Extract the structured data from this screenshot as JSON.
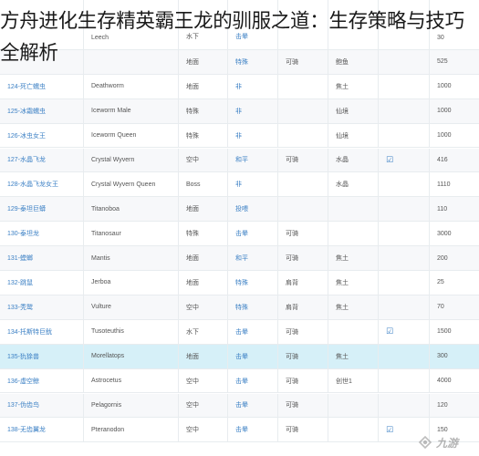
{
  "title": "方舟进化生存精英霸王龙的驯服之道：生存策略与技巧全解析",
  "rows": [
    {
      "id": "",
      "name": "Leech",
      "type": "水下",
      "taming": "击晕",
      "ride": "",
      "food": "",
      "check": "",
      "value": "30"
    },
    {
      "id": "",
      "name": "",
      "type": "地面",
      "taming": "特殊",
      "ride": "可骑",
      "food": "鲍鱼",
      "check": "",
      "value": "525"
    },
    {
      "id": "124-死亡蠕虫",
      "name": "Deathworm",
      "type": "地面",
      "taming": "非",
      "ride": "",
      "food": "焦土",
      "check": "",
      "value": "1000"
    },
    {
      "id": "125-冰霜蠕虫",
      "name": "Iceworm Male",
      "type": "特殊",
      "taming": "非",
      "ride": "",
      "food": "仙境",
      "check": "",
      "value": "1000"
    },
    {
      "id": "126-冰虫女王",
      "name": "Iceworm Queen",
      "type": "特殊",
      "taming": "非",
      "ride": "",
      "food": "仙境",
      "check": "",
      "value": "1000"
    },
    {
      "id": "127-水晶飞龙",
      "name": "Crystal Wyvern",
      "type": "空中",
      "taming": "和平",
      "ride": "可骑",
      "food": "水晶",
      "check": "☑",
      "value": "416"
    },
    {
      "id": "128-水晶飞龙女王",
      "name": "Crystal Wyvern Queen",
      "type": "Boss",
      "taming": "非",
      "ride": "",
      "food": "水晶",
      "check": "",
      "value": "1110"
    },
    {
      "id": "129-泰坦巨蟒",
      "name": "Titanoboa",
      "type": "地面",
      "taming": "投喂",
      "ride": "",
      "food": "",
      "check": "",
      "value": "110"
    },
    {
      "id": "130-泰坦龙",
      "name": "Titanosaur",
      "type": "特殊",
      "taming": "击晕",
      "ride": "可骑",
      "food": "",
      "check": "",
      "value": "3000"
    },
    {
      "id": "131-螳螂",
      "name": "Mantis",
      "type": "地面",
      "taming": "和平",
      "ride": "可骑",
      "food": "焦土",
      "check": "",
      "value": "200"
    },
    {
      "id": "132-跳鼠",
      "name": "Jerboa",
      "type": "地面",
      "taming": "特殊",
      "ride": "肩背",
      "food": "焦土",
      "check": "",
      "value": "25"
    },
    {
      "id": "133-秃鹫",
      "name": "Vulture",
      "type": "空中",
      "taming": "特殊",
      "ride": "肩背",
      "food": "焦土",
      "check": "",
      "value": "70"
    },
    {
      "id": "134-托斯特巨鱿",
      "name": "Tusoteuthis",
      "type": "水下",
      "taming": "击晕",
      "ride": "可骑",
      "food": "",
      "check": "☑",
      "value": "1500"
    },
    {
      "id": "135-犰狳兽",
      "name": "Morellatops",
      "type": "地面",
      "taming": "击晕",
      "ride": "可骑",
      "food": "焦土",
      "check": "",
      "value": "300"
    },
    {
      "id": "136-虚空鲸",
      "name": "Astrocetus",
      "type": "空中",
      "taming": "击晕",
      "ride": "可骑",
      "food": "创世1",
      "check": "",
      "value": "4000"
    },
    {
      "id": "137-伪齿鸟",
      "name": "Pelagornis",
      "type": "空中",
      "taming": "击晕",
      "ride": "可骑",
      "food": "",
      "check": "",
      "value": "120"
    },
    {
      "id": "138-无齿翼龙",
      "name": "Pteranodon",
      "type": "空中",
      "taming": "击晕",
      "ride": "可骑",
      "food": "",
      "check": "☑",
      "value": "150"
    }
  ],
  "watermark": {
    "text": "九游"
  }
}
